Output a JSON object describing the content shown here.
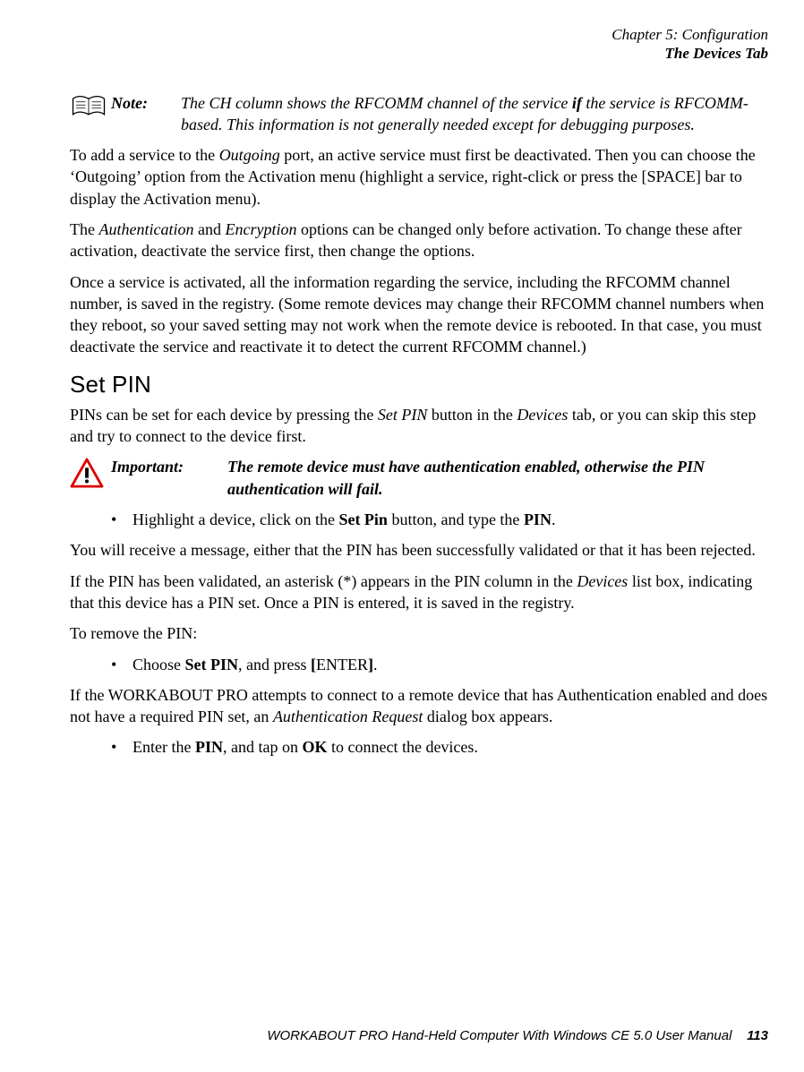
{
  "header": {
    "chapter": "Chapter 5: Configuration",
    "section": "The Devices Tab"
  },
  "note": {
    "label": "Note:",
    "text_1": "The CH column shows the RFCOMM channel of the service ",
    "text_if": "if",
    "text_2": " the service is RFCOMM-based. This information is not generally needed except for debugging purposes."
  },
  "p1_a": "To add a service to the ",
  "p1_i1": "Outgoing",
  "p1_b": " port, an active service must first be deactivated. Then you can choose the ‘Outgoing’ option from the Activation menu (highlight a service, right-click or press the [SPACE] bar to display the Activation menu).",
  "p2_a": "The ",
  "p2_i1": "Authentication",
  "p2_b": " and ",
  "p2_i2": "Encryption",
  "p2_c": " options can be changed only before activation. To change these after activation, deactivate the service first, then change the options.",
  "p3": "Once a service is activated, all the information regarding the service, including the RFCOMM channel number, is saved in the registry. (Some remote devices may change their RFCOMM channel numbers when they reboot, so your saved setting may not work when the remote device is rebooted. In that case, you must deactivate the service and reactivate it to detect the current RFCOMM channel.)",
  "h_setpin": "Set PIN",
  "p4_a": "PINs can be set for each device by pressing the ",
  "p4_i1": "Set PIN",
  "p4_b": " button in the ",
  "p4_i2": "Devices",
  "p4_c": " tab, or you can skip this step and try to connect to the device first.",
  "important": {
    "label": "Important:",
    "text": "The remote device must have authentication enabled, otherwise the PIN authentication will fail."
  },
  "li1_a": "Highlight a device, click on the ",
  "li1_b1": "Set Pin",
  "li1_b": " button, and type the ",
  "li1_b2": "PIN",
  "li1_c": ".",
  "p5": "You will receive a message, either that the PIN has been successfully validated or that it has been rejected.",
  "p6_a": "If the PIN has been validated, an asterisk (*) appears in the PIN column in the ",
  "p6_i1": "Devices",
  "p6_b": " list box, indicating that this device has a PIN set. Once a PIN is entered, it is saved in the registry.",
  "p7": "To remove the PIN:",
  "li2_a": "Choose ",
  "li2_b1": "Set PIN",
  "li2_b": ", and press ",
  "li2_b2": "[",
  "li2_b3": "ENTER",
  "li2_b4": "]",
  "li2_c": ".",
  "p8_a": "If the WORKABOUT PRO attempts to connect to a remote device that has Authentication enabled and does not have a required PIN set, an ",
  "p8_i1": "Authentication Request",
  "p8_b": " dialog box appears.",
  "li3_a": "Enter the ",
  "li3_b1": "PIN",
  "li3_b": ", and tap on ",
  "li3_b2": "OK",
  "li3_c": " to connect the devices.",
  "footer": {
    "title": "WORKABOUT PRO Hand-Held Computer With Windows CE 5.0 User Manual",
    "page": "113"
  }
}
